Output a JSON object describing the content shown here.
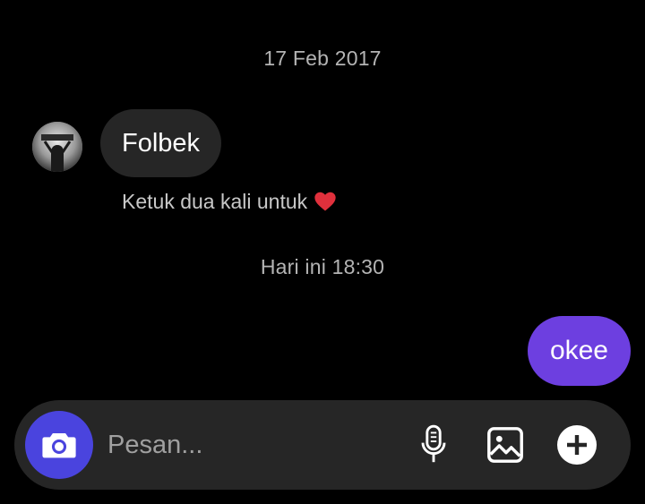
{
  "conversation": {
    "timestamp_1": "17 Feb 2017",
    "incoming_message": "Folbek",
    "double_tap_hint": "Ketuk dua kali untuk",
    "heart_icon": "heart-icon",
    "timestamp_2": "Hari ini 18:30",
    "outgoing_message": "okee"
  },
  "composer": {
    "placeholder": "Pesan...",
    "camera_icon": "camera-icon",
    "mic_icon": "microphone-icon",
    "gallery_icon": "image-icon",
    "add_icon": "plus-circle-icon"
  },
  "colors": {
    "background": "#000000",
    "incoming_bubble": "#262626",
    "outgoing_bubble": "#6d3fe0",
    "camera_button": "#4a44de",
    "heart": "#e0303c"
  }
}
